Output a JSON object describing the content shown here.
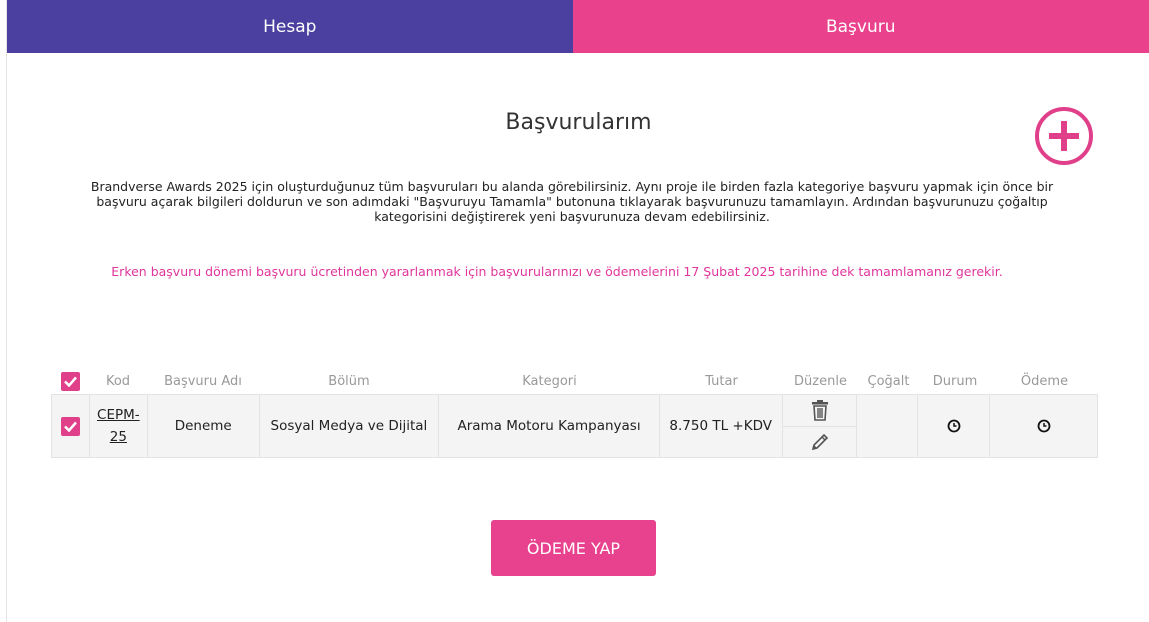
{
  "tabs": {
    "account": "Hesap",
    "application": "Başvuru"
  },
  "page": {
    "title": "Başvurularım",
    "intro": "Brandverse Awards 2025 için oluşturduğunuz tüm başvuruları bu alanda görebilirsiniz. Aynı proje ile birden fazla kategoriye başvuru yapmak için önce bir başvuru açarak bilgileri doldurun ve son adımdaki \"Başvuruyu Tamamla\" butonuna tıklayarak başvurunuzu tamamlayın. Ardından başvurunuzu çoğaltıp kategorisini değiştirerek yeni başvurunuza devam edebilirsiniz.",
    "notice": "Erken başvuru dönemi başvuru ücretinden yararlanmak için başvurularınızı ve ödemelerini 17 Şubat 2025 tarihine dek tamamlamanız gerekir."
  },
  "table": {
    "headers": {
      "kod": "Kod",
      "ad": "Başvuru Adı",
      "bolum": "Bölüm",
      "kategori": "Kategori",
      "tutar": "Tutar",
      "duzenle": "Düzenle",
      "cogalt": "Çoğalt",
      "durum": "Durum",
      "odeme": "Ödeme"
    },
    "rows": [
      {
        "checked": true,
        "kod": "CEPM-25",
        "ad": "Deneme",
        "bolum": "Sosyal Medya ve Dijital",
        "kategori": "Arama Motoru Kampanyası",
        "tutar": "8.750 TL +KDV",
        "durum_icon": "clock-icon",
        "odeme_icon": "clock-icon"
      }
    ]
  },
  "actions": {
    "pay_label": "ÖDEME YAP",
    "add_icon": "plus-circle-icon"
  },
  "colors": {
    "account_tab": "#4b3fa0",
    "accent_pink": "#ea418c",
    "notice_text": "#e0359c"
  }
}
